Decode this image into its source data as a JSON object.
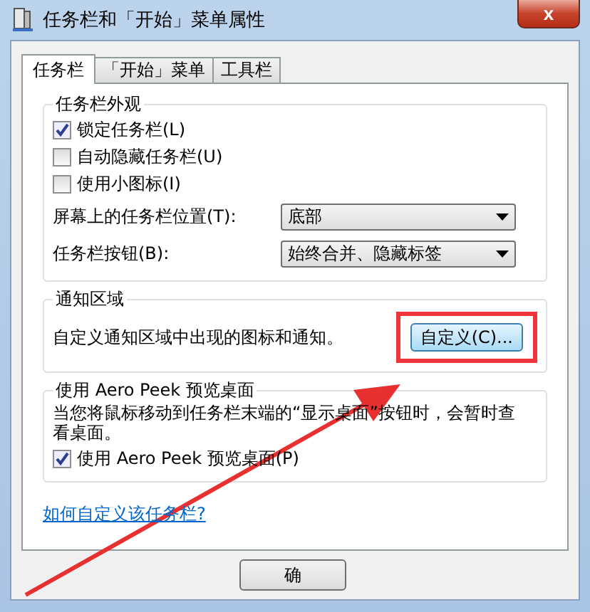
{
  "window": {
    "title": "任务栏和「开始」菜单属性",
    "close": "x"
  },
  "tabs": [
    {
      "label": "任务栏",
      "selected": true
    },
    {
      "label": "「开始」菜单",
      "selected": false
    },
    {
      "label": "工具栏",
      "selected": false
    }
  ],
  "appearance": {
    "title": "任务栏外观",
    "checkboxes": [
      {
        "label": "锁定任务栏(L)",
        "checked": true
      },
      {
        "label": "自动隐藏任务栏(U)",
        "checked": false
      },
      {
        "label": "使用小图标(I)",
        "checked": false
      }
    ],
    "dropdowns": [
      {
        "label": "屏幕上的任务栏位置(T):",
        "value": "底部"
      },
      {
        "label": "任务栏按钮(B):",
        "value": "始终合并、隐藏标签"
      }
    ]
  },
  "notification": {
    "title": "通知区域",
    "text": "自定义通知区域中出现的图标和通知。",
    "button": "自定义(C)...",
    "highlighted": true
  },
  "aero_peek": {
    "title": "使用 Aero Peek 预览桌面",
    "text": "当您将鼠标移动到任务栏末端的“显示桌面”按钮时，会暂时查看桌面。",
    "checkbox": {
      "label": "使用 Aero Peek 预览桌面(P)",
      "checked": true
    }
  },
  "link": "如何自定义该任务栏?",
  "buttons": [
    "确"
  ],
  "annotation": {
    "arrow": true
  }
}
